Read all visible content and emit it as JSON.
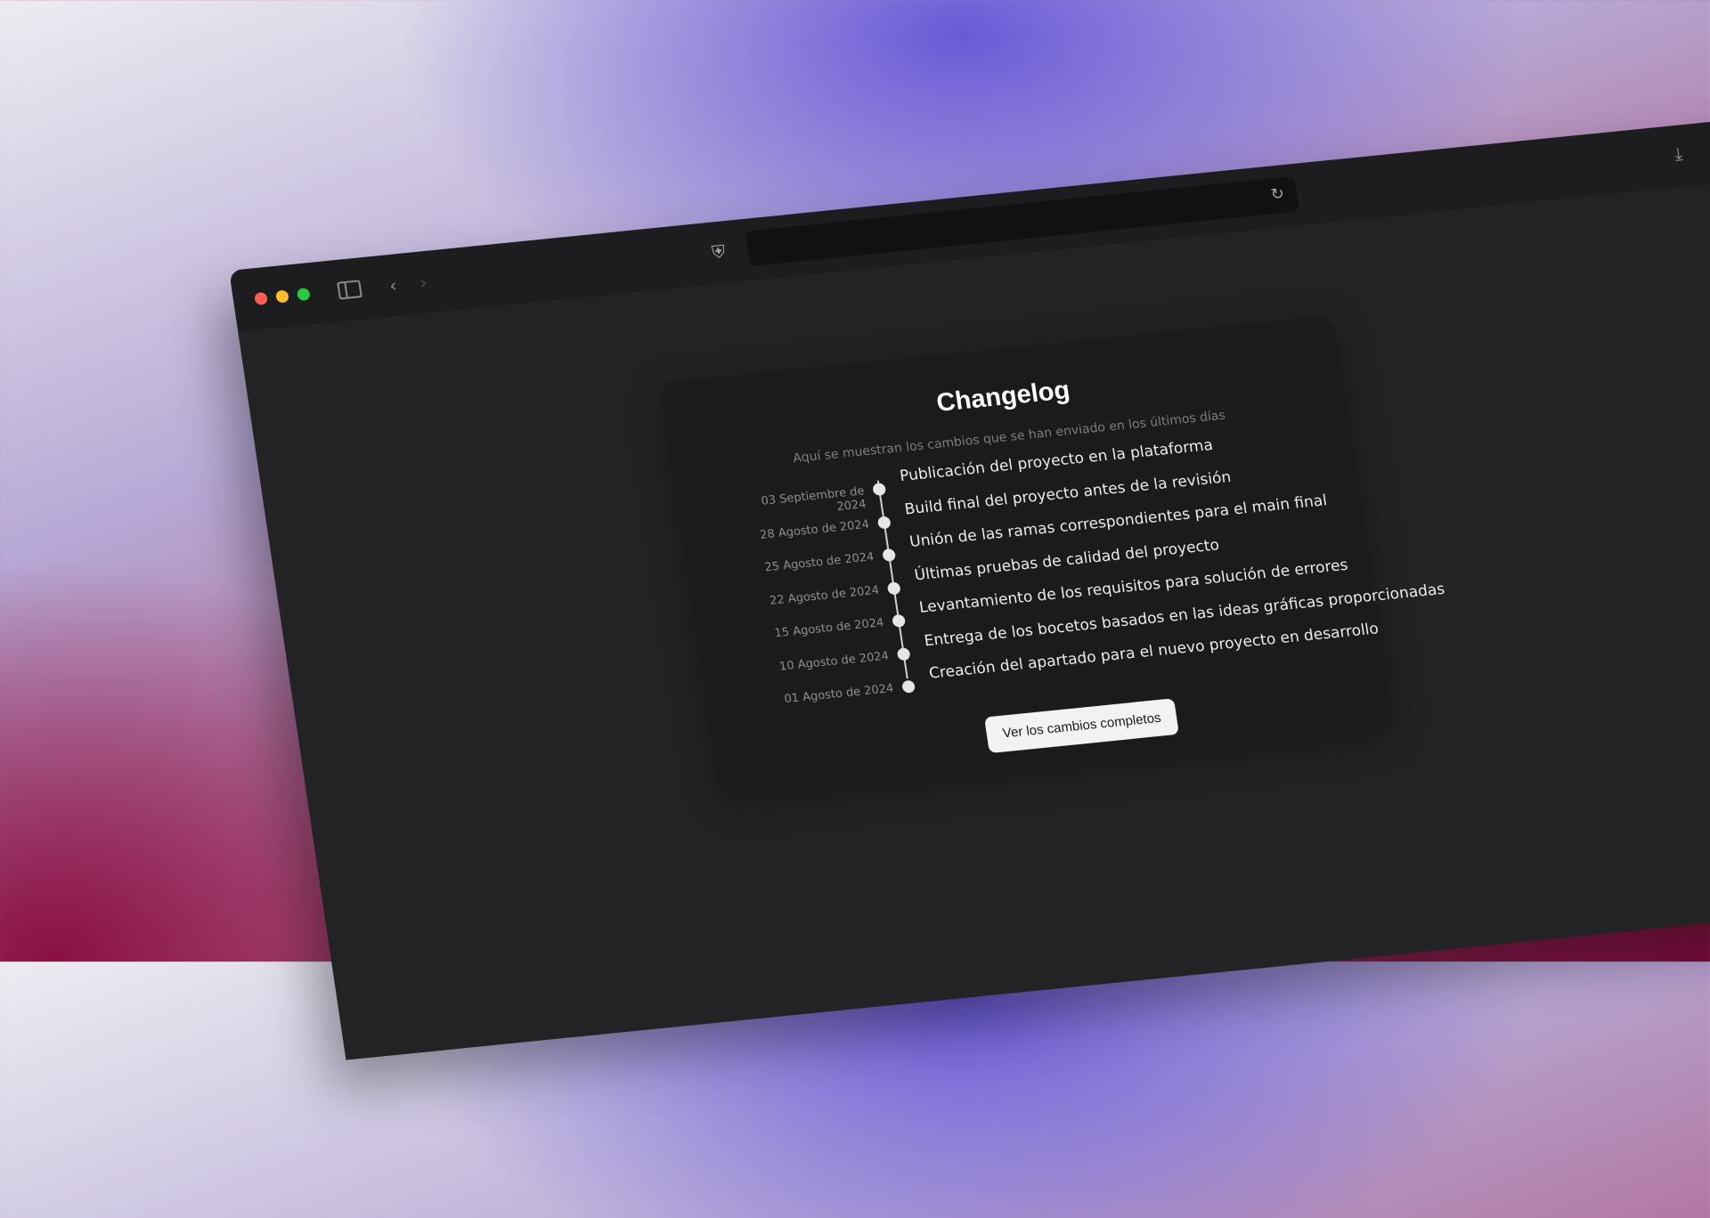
{
  "browser": {
    "url": "",
    "icons": {
      "sidebar": "sidebar-icon",
      "back": "chevron-left-icon",
      "forward": "chevron-right-icon",
      "shield": "shield-icon",
      "reload": "reload-icon",
      "download": "download-icon",
      "share": "share-icon"
    }
  },
  "changelog": {
    "title": "Changelog",
    "subtitle": "Aquí se muestran los cambios que se han enviado en los últimos días",
    "entries": [
      {
        "date": "03 Septiembre de 2024",
        "text": "Publicación del proyecto en la plataforma"
      },
      {
        "date": "28 Agosto de 2024",
        "text": "Build final del proyecto antes de la revisión"
      },
      {
        "date": "25 Agosto de 2024",
        "text": "Unión de las ramas correspondientes para el main final"
      },
      {
        "date": "22 Agosto de 2024",
        "text": "Últimas pruebas de calidad del proyecto"
      },
      {
        "date": "15 Agosto de 2024",
        "text": "Levantamiento de los requisitos para solución de errores"
      },
      {
        "date": "10 Agosto de 2024",
        "text": "Entrega de los bocetos basados en las ideas gráficas proporcionadas"
      },
      {
        "date": "01 Agosto de 2024",
        "text": "Creación del apartado para el nuevo proyecto en desarrollo"
      }
    ],
    "button_label": "Ver los cambios completos"
  },
  "colors": {
    "window_bg": "#222224",
    "card_bg": "#1b1b1c",
    "traffic_red": "#ff5f57",
    "traffic_yellow": "#febc2e",
    "traffic_green": "#28c840"
  }
}
